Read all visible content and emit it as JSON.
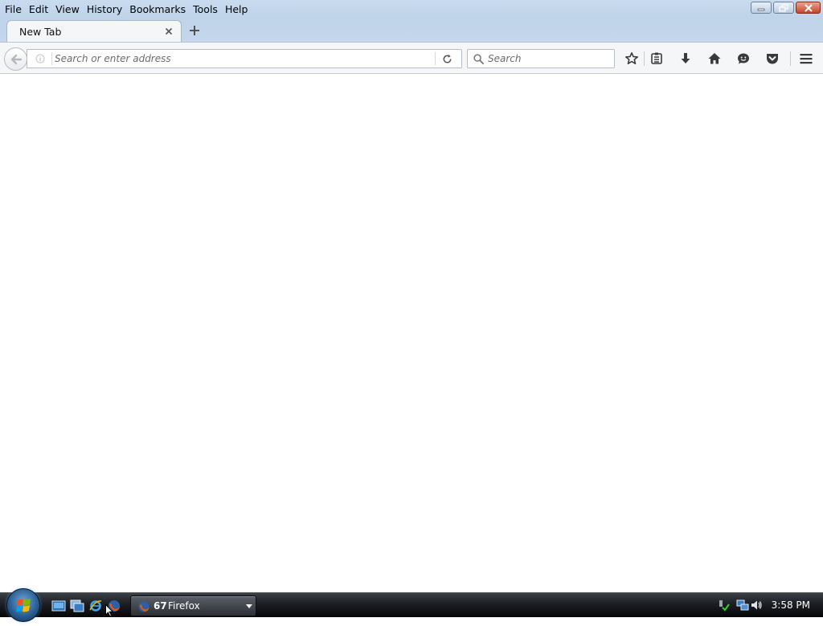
{
  "menubar": {
    "items": [
      "File",
      "Edit",
      "View",
      "History",
      "Bookmarks",
      "Tools",
      "Help"
    ]
  },
  "window_controls": {
    "minimize_icon": "minimize-icon",
    "restore_icon": "restore-icon",
    "close_icon": "close-icon"
  },
  "tabs": [
    {
      "label": "New Tab",
      "active": true
    }
  ],
  "navbar": {
    "url": {
      "value": "",
      "placeholder": "Search or enter address"
    },
    "search": {
      "value": "",
      "placeholder": "Search"
    },
    "toolbar_icons": [
      "star-icon",
      "bookmarks-menu-icon",
      "download-icon",
      "home-icon",
      "hello-icon",
      "pocket-icon",
      "hamburger-menu-icon"
    ]
  },
  "taskbar": {
    "quick_launch": [
      "show-desktop-icon",
      "switch-windows-icon",
      "internet-explorer-icon",
      "firefox-icon"
    ],
    "task": {
      "count": "67",
      "label": "Firefox"
    },
    "tray": {
      "icons": [
        "safely-remove-icon",
        "network-icon",
        "volume-icon"
      ],
      "clock": "3:58 PM"
    }
  },
  "colors": {
    "titlebar": "#c9dbee",
    "toolbar": "#f5f6f7",
    "taskbar": "#1c1f23",
    "close_button": "#c6452b"
  }
}
